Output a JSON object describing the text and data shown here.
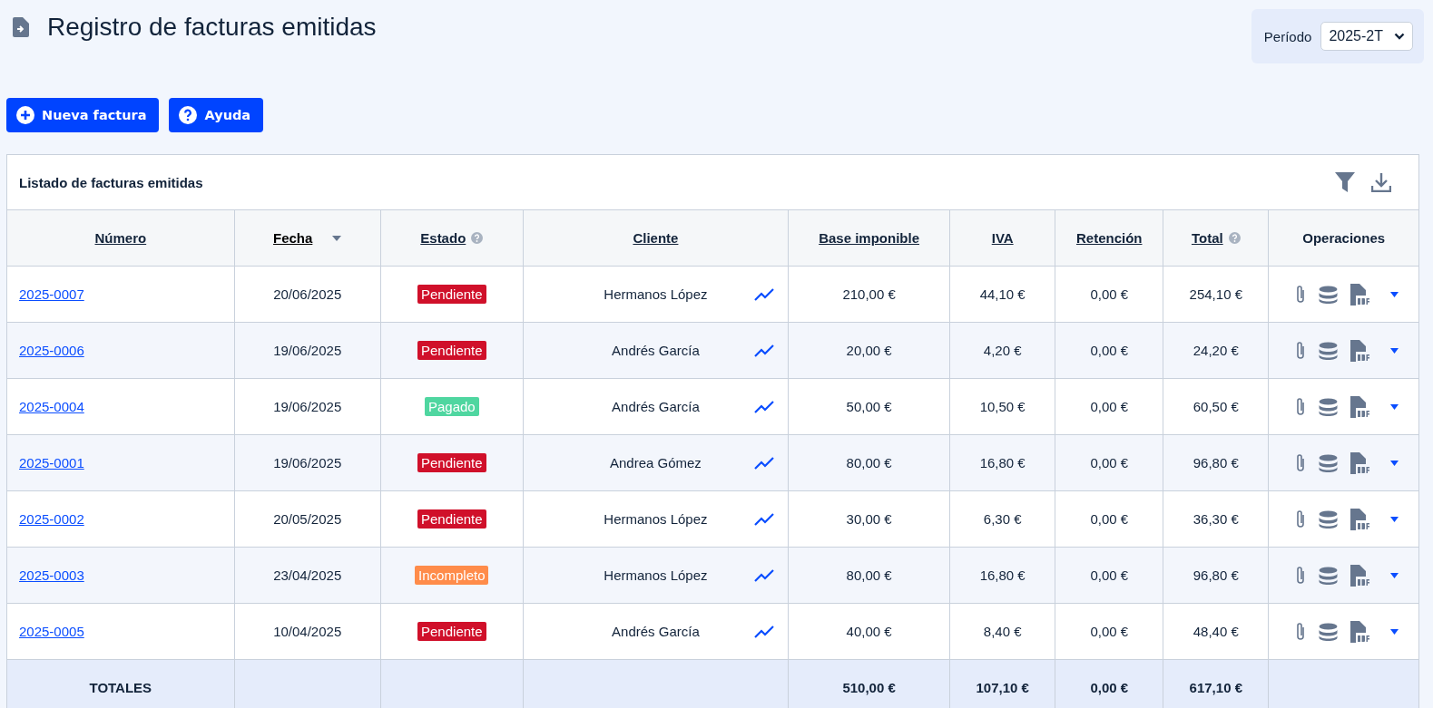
{
  "page": {
    "title": "Registro de facturas emitidas"
  },
  "period": {
    "label": "Período",
    "value": "2025-2T"
  },
  "actions": [
    {
      "kind": "new",
      "label": "Nueva factura"
    },
    {
      "kind": "help",
      "label": "Ayuda"
    }
  ],
  "table": {
    "title": "Listado de facturas emitidas",
    "columns": [
      {
        "label": "Número",
        "link": true,
        "help": false,
        "sorted": false
      },
      {
        "label": "Fecha",
        "link": true,
        "help": false,
        "sorted": true
      },
      {
        "label": "Estado",
        "link": true,
        "help": true,
        "sorted": false
      },
      {
        "label": "Cliente",
        "link": true,
        "help": false,
        "sorted": false
      },
      {
        "label": "Base imponible",
        "link": true,
        "help": false,
        "sorted": false
      },
      {
        "label": "IVA",
        "link": true,
        "help": false,
        "sorted": false
      },
      {
        "label": "Retención",
        "link": true,
        "help": false,
        "sorted": false
      },
      {
        "label": "Total",
        "link": true,
        "help": true,
        "sorted": false
      },
      {
        "label": "Operaciones",
        "link": false,
        "help": false,
        "sorted": false
      }
    ],
    "rows": [
      {
        "number": "2025-0007",
        "date": "20/06/2025",
        "status": {
          "label": "Pendiente",
          "color": "#d0102a"
        },
        "client": "Hermanos López",
        "base": "210,00 €",
        "iva": "44,10 €",
        "retention": "0,00 €",
        "total": "254,10 €"
      },
      {
        "number": "2025-0006",
        "date": "19/06/2025",
        "status": {
          "label": "Pendiente",
          "color": "#d0102a"
        },
        "client": "Andrés García",
        "base": "20,00 €",
        "iva": "4,20 €",
        "retention": "0,00 €",
        "total": "24,20 €"
      },
      {
        "number": "2025-0004",
        "date": "19/06/2025",
        "status": {
          "label": "Pagado",
          "color": "#4fd6a0"
        },
        "client": "Andrés García",
        "base": "50,00 €",
        "iva": "10,50 €",
        "retention": "0,00 €",
        "total": "60,50 €"
      },
      {
        "number": "2025-0001",
        "date": "19/06/2025",
        "status": {
          "label": "Pendiente",
          "color": "#d0102a"
        },
        "client": "Andrea Gómez",
        "base": "80,00 €",
        "iva": "16,80 €",
        "retention": "0,00 €",
        "total": "96,80 €"
      },
      {
        "number": "2025-0002",
        "date": "20/05/2025",
        "status": {
          "label": "Pendiente",
          "color": "#d0102a"
        },
        "client": "Hermanos López",
        "base": "30,00 €",
        "iva": "6,30 €",
        "retention": "0,00 €",
        "total": "36,30 €"
      },
      {
        "number": "2025-0003",
        "date": "23/04/2025",
        "status": {
          "label": "Incompleto",
          "color": "#ff8c4a"
        },
        "client": "Hermanos López",
        "base": "80,00 €",
        "iva": "16,80 €",
        "retention": "0,00 €",
        "total": "96,80 €"
      },
      {
        "number": "2025-0005",
        "date": "10/04/2025",
        "status": {
          "label": "Pendiente",
          "color": "#d0102a"
        },
        "client": "Andrés García",
        "base": "40,00 €",
        "iva": "8,40 €",
        "retention": "0,00 €",
        "total": "48,40 €"
      }
    ],
    "totals": {
      "label": "TOTALES",
      "base": "510,00 €",
      "iva": "107,10 €",
      "retention": "0,00 €",
      "total": "617,10 €"
    }
  }
}
